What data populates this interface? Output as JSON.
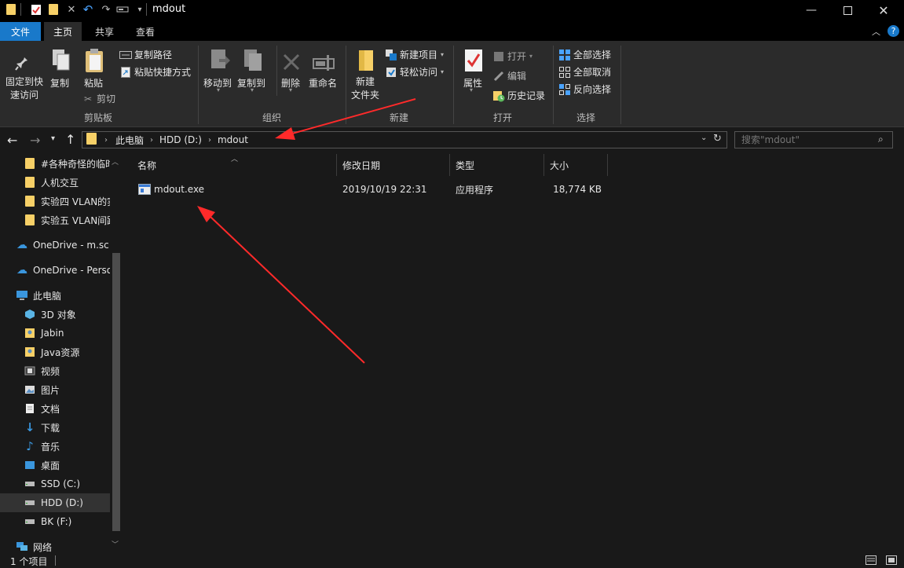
{
  "window": {
    "title": "mdout"
  },
  "ribbon_tabs": [
    "文件",
    "主页",
    "共享",
    "查看"
  ],
  "clipboard": {
    "pin_label": "固定到快\n速访问",
    "copy_label": "复制",
    "paste_label": "粘贴",
    "copy_path": "复制路径",
    "paste_shortcut": "粘贴快捷方式",
    "cut": "剪切",
    "group": "剪贴板"
  },
  "organize": {
    "move_to": "移动到",
    "copy_to": "复制到",
    "delete": "删除",
    "rename": "重命名",
    "group": "组织"
  },
  "new": {
    "new_folder": "新建\n文件夹",
    "new_item": "新建项目",
    "easy_access": "轻松访问",
    "group": "新建"
  },
  "open": {
    "properties": "属性",
    "open": "打开",
    "edit": "编辑",
    "history": "历史记录",
    "group": "打开"
  },
  "select": {
    "select_all": "全部选择",
    "select_none": "全部取消",
    "invert": "反向选择",
    "group": "选择"
  },
  "address": {
    "crumbs": [
      "此电脑",
      "HDD (D:)",
      "mdout"
    ],
    "search_placeholder": "搜索\"mdout\""
  },
  "sidebar": {
    "items": [
      {
        "label": "#各种奇怪的临时",
        "icon": "folder-icon"
      },
      {
        "label": "人机交互",
        "icon": "folder-icon"
      },
      {
        "label": "实验四 VLAN的实",
        "icon": "folder-icon"
      },
      {
        "label": "实验五 VLAN间路",
        "icon": "folder-icon"
      },
      {
        "label": "OneDrive - m.sc",
        "icon": "cloud-icon"
      },
      {
        "label": "OneDrive - Perso",
        "icon": "cloud-icon"
      },
      {
        "label": "此电脑",
        "icon": "computer-icon"
      },
      {
        "label": "3D 对象",
        "icon": "cube-icon"
      },
      {
        "label": "Jabin",
        "icon": "folder-user-icon"
      },
      {
        "label": "Java资源",
        "icon": "folder-user-icon"
      },
      {
        "label": "视频",
        "icon": "video-icon"
      },
      {
        "label": "图片",
        "icon": "picture-icon"
      },
      {
        "label": "文档",
        "icon": "document-icon"
      },
      {
        "label": "下载",
        "icon": "download-icon"
      },
      {
        "label": "音乐",
        "icon": "music-icon"
      },
      {
        "label": "桌面",
        "icon": "desktop-icon"
      },
      {
        "label": "SSD (C:)",
        "icon": "drive-icon"
      },
      {
        "label": "HDD (D:)",
        "icon": "drive-icon"
      },
      {
        "label": "BK (F:)",
        "icon": "drive-icon"
      },
      {
        "label": "网络",
        "icon": "network-icon"
      }
    ]
  },
  "columns": [
    "名称",
    "修改日期",
    "类型",
    "大小"
  ],
  "files": [
    {
      "name": "mdout.exe",
      "modified": "2019/10/19 22:31",
      "type": "应用程序",
      "size": "18,774 KB"
    }
  ],
  "status": {
    "count": "1 个项目"
  },
  "colors": {
    "accent": "#1979ca",
    "annotation_arrow": "#ff2a2a",
    "folder": "#f7d067"
  }
}
